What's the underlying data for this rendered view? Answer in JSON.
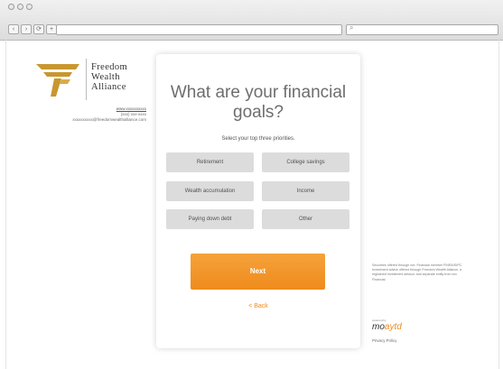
{
  "browser": {
    "search_icon": "search-icon"
  },
  "logo": {
    "line1": "Freedom",
    "line2": "Wealth",
    "line3": "Alliance",
    "colors": {
      "gold": "#c8972f",
      "text": "#333333"
    }
  },
  "contact": {
    "link": "www.xxxxxxxxxx",
    "phone": "(xxx) xxx-xxxx",
    "email": "xxxxxxxxxx@freedomwealthalliance.com"
  },
  "card": {
    "title": "What are your financial goals?",
    "subtitle": "Select your top three priorities.",
    "options": [
      {
        "label": "Retirement"
      },
      {
        "label": "College savings"
      },
      {
        "label": "Wealth accumulation"
      },
      {
        "label": "Income"
      },
      {
        "label": "Paying down debt"
      },
      {
        "label": "Other"
      }
    ],
    "next_label": "Next",
    "back_label": "< Back"
  },
  "sidebar": {
    "disclaimer": "Securities offered through xxx. Financial member FINRA/SIPC. Investment advice offered through Freedom Wealth Alliance, a registered investment advisor, and separate entity from xxx Financial.",
    "powered_by": "powered by",
    "brand_main": "mo",
    "brand_accent": "aytd",
    "privacy": "Privacy Policy"
  },
  "colors": {
    "accent": "#ef8b1c",
    "option_bg": "#dcdcdc",
    "title_text": "#6d6d6d"
  }
}
